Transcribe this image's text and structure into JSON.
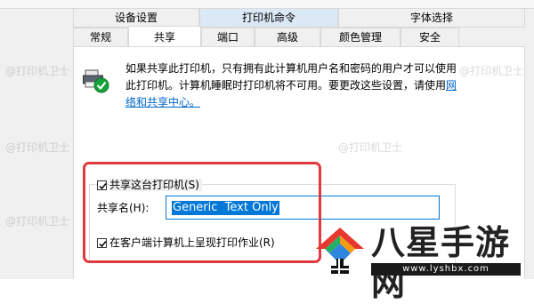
{
  "tabs_row1": [
    "设备设置",
    "打印机命令",
    "字体选择"
  ],
  "tabs_row2": [
    "常规",
    "共享",
    "端口",
    "高级",
    "颜色管理",
    "安全"
  ],
  "info": {
    "text": "如果共享此打印机，只有拥有此计算机用户名和密码的用户才可以使用此打印机。计算机睡眠时打印机将不可用。要更改这些设置，请使用",
    "link": "网络和共享中心。"
  },
  "share_checkbox": {
    "label": "共享这台打印机(S)",
    "checked": true
  },
  "share_name": {
    "label": "共享名(H):",
    "value": "Generic  Text Only"
  },
  "render_checkbox": {
    "label": "在客户端计算机上呈现打印作业(R)",
    "checked": true
  },
  "watermark": "@打印机卫士",
  "brand": {
    "title": "八星手游网",
    "url": "www.lyshbx.com"
  },
  "colors": {
    "accent": "#0078d7",
    "highlight": "#e0393e",
    "link": "#0066cc"
  }
}
